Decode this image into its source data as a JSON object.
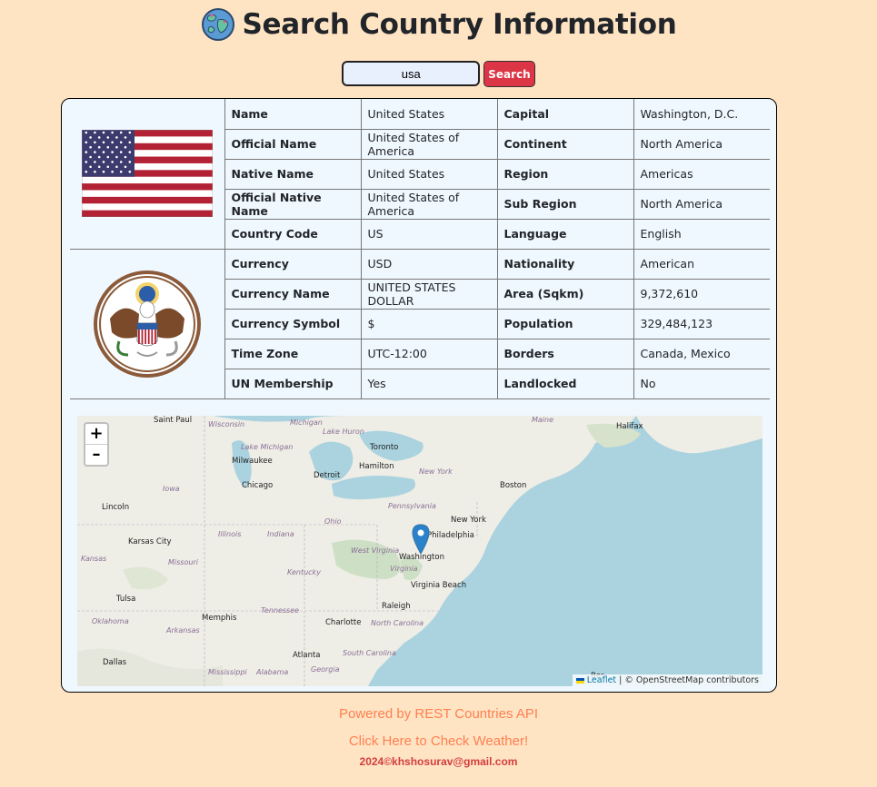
{
  "header": {
    "title": "Search Country Information",
    "icon": "globe-icon"
  },
  "search": {
    "value": "usa",
    "button_label": "Search"
  },
  "rows": [
    {
      "l1": "Name",
      "v1": "United States",
      "l2": "Capital",
      "v2": "Washington, D.C."
    },
    {
      "l1": "Official Name",
      "v1": "United States of America",
      "l2": "Continent",
      "v2": "North America"
    },
    {
      "l1": "Native Name",
      "v1": "United States",
      "l2": "Region",
      "v2": "Americas"
    },
    {
      "l1": "Official Native Name",
      "v1": "United States of America",
      "l2": "Sub Region",
      "v2": "North America"
    },
    {
      "l1": "Country Code",
      "v1": "US",
      "l2": "Language",
      "v2": "English"
    },
    {
      "l1": "Currency",
      "v1": "USD",
      "l2": "Nationality",
      "v2": "American"
    },
    {
      "l1": "Currency Name",
      "v1": "UNITED STATES DOLLAR",
      "l2": "Area (Sqkm)",
      "v2": "9,372,610"
    },
    {
      "l1": "Currency Symbol",
      "v1": "$",
      "l2": "Population",
      "v2": "329,484,123"
    },
    {
      "l1": "Time Zone",
      "v1": "UTC-12:00",
      "l2": "Borders",
      "v2": "Canada, Mexico"
    },
    {
      "l1": "UN Membership",
      "v1": "Yes",
      "l2": "Landlocked",
      "v2": "No"
    }
  ],
  "map": {
    "zoom_in": "+",
    "zoom_out": "–",
    "attribution_leaflet": "Leaflet",
    "attribution_rest": " | © OpenStreetMap contributors",
    "places": {
      "saint_paul": "Saint Paul",
      "wisconsin": "Wisconsin",
      "michigan": "Michigan",
      "lake_huron": "Lake Huron",
      "maine": "Maine",
      "halifax": "Halifax",
      "lake_michigan": "Lake Michigan",
      "toronto": "Toronto",
      "milwaukee": "Milwaukee",
      "hamilton": "Hamilton",
      "new_york_state": "New York",
      "detroit": "Detroit",
      "chicago": "Chicago",
      "iowa": "Iowa",
      "boston": "Boston",
      "pennsylvania": "Pennsylvania",
      "lincoln": "Lincoln",
      "ohio": "Ohio",
      "new_york": "New York",
      "illinois": "Illinois",
      "indiana": "Indiana",
      "karsas_city": "Karsas City",
      "philadelphia": "Philadelphia",
      "west_virginia": "West Virginia",
      "kansas": "Kansas",
      "missouri": "Missouri",
      "washington": "Washington",
      "virginia": "Virginia",
      "kentucky": "Kentucky",
      "virginia_beach": "Virginia Beach",
      "tulsa": "Tulsa",
      "raleigh": "Raleigh",
      "tennessee": "Tennessee",
      "oklahoma": "Oklahoma",
      "memphis": "Memphis",
      "charlotte": "Charlotte",
      "north_carolina": "North Carolina",
      "arkansas": "Arkansas",
      "atlanta": "Atlanta",
      "south_carolina": "South Carolina",
      "dallas": "Dallas",
      "mississippi": "Mississippi",
      "alabama": "Alabama",
      "georgia": "Georgia",
      "bermuda": "Ber"
    }
  },
  "footer": {
    "powered": "Powered by REST Countries API",
    "weather": "Click Here to Check Weather!",
    "copyright": "2024©khshosurav@gmail.com"
  }
}
